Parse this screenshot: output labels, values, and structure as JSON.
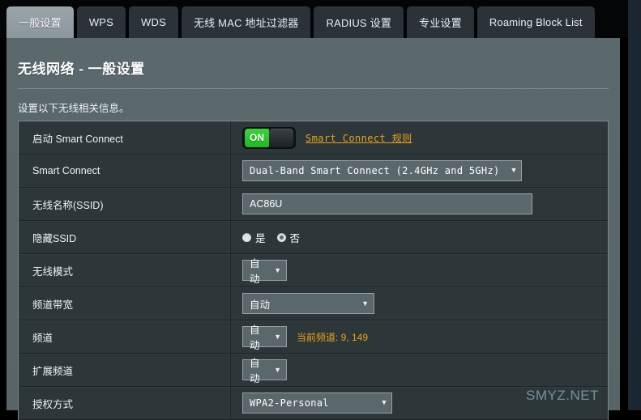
{
  "tabs": [
    {
      "label": "一般设置",
      "active": true
    },
    {
      "label": "WPS",
      "active": false
    },
    {
      "label": "WDS",
      "active": false
    },
    {
      "label": "无线 MAC 地址过滤器",
      "active": false
    },
    {
      "label": "RADIUS 设置",
      "active": false
    },
    {
      "label": "专业设置",
      "active": false
    },
    {
      "label": "Roaming Block List",
      "active": false
    }
  ],
  "panel": {
    "title": "无线网络 - 一般设置",
    "description": "设置以下无线相关信息。"
  },
  "rows": {
    "smart_connect_enable": {
      "label": "启动 Smart Connect",
      "toggle_state": "ON",
      "link_label": "Smart Connect 规则"
    },
    "smart_connect": {
      "label": "Smart Connect",
      "value": "Dual-Band Smart Connect (2.4GHz and 5GHz)"
    },
    "ssid": {
      "label": "无线名称(SSID)",
      "value": "AC86U",
      "placeholder": ""
    },
    "hide_ssid": {
      "label": "隐藏SSID",
      "options": [
        {
          "label": "是",
          "checked": false
        },
        {
          "label": "否",
          "checked": true
        }
      ]
    },
    "wireless_mode": {
      "label": "无线模式",
      "value": "自动"
    },
    "channel_bandwidth": {
      "label": "频道带宽",
      "value": "自动"
    },
    "channel": {
      "label": "频道",
      "value": "自动",
      "note": "当前频道: 9, 149"
    },
    "extension_channel": {
      "label": "扩展频道",
      "value": "自动"
    },
    "auth_method": {
      "label": "授权方式",
      "value": "WPA2-Personal"
    }
  },
  "watermark": "SMYZ.NET",
  "icons": {
    "caret_down": "▼"
  },
  "colors": {
    "accent_orange": "#e8a318",
    "toggle_on_green": "#2fc72f",
    "panel_bg": "#5a676b",
    "row_bg": "#2d3639"
  }
}
